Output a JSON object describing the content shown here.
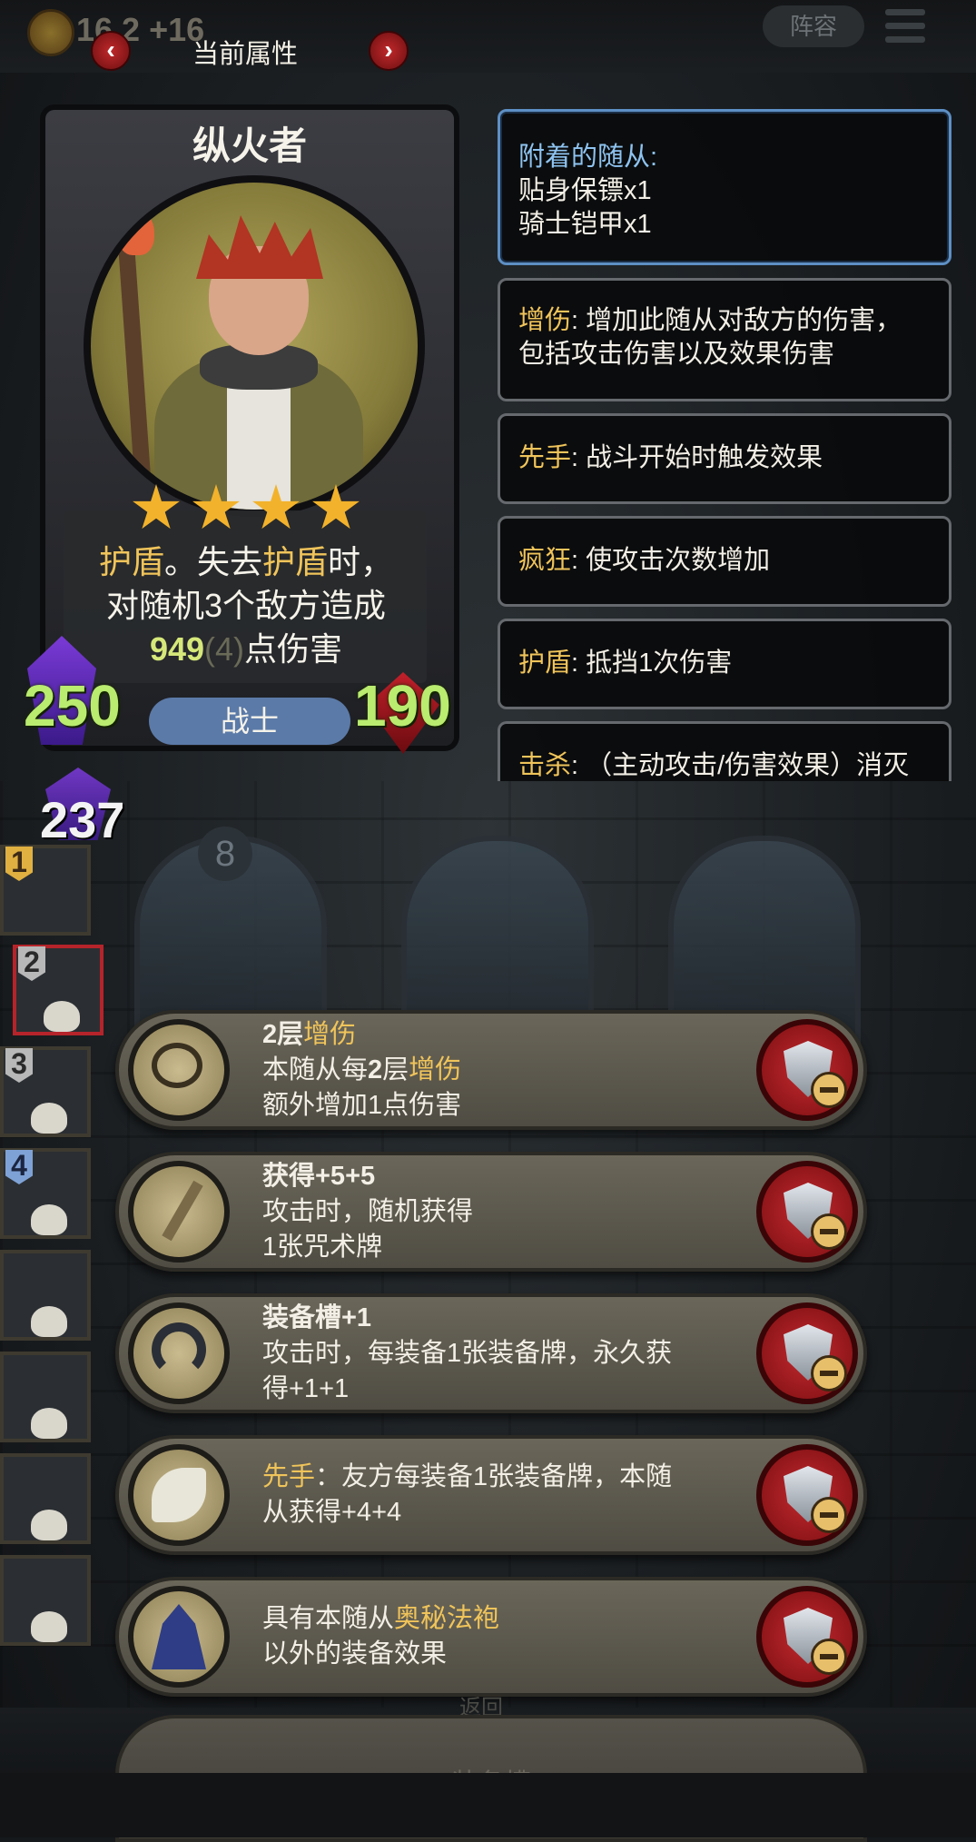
{
  "topbar": {
    "gold": "16 2 +16",
    "title": "当前属性",
    "prev": "‹",
    "next": "›",
    "lineup_label": "阵容"
  },
  "hero": {
    "name": "纵火者",
    "stars": 4,
    "desc_line1_a": "护盾",
    "desc_line1_b": "。失去",
    "desc_line1_c": "护盾",
    "desc_line1_d": "时，",
    "desc_line2": "对随机3个敌方造成",
    "desc_line3_num": "949",
    "desc_line3_sub": "(4)",
    "desc_line3_tail": "点伤害",
    "attack": "250",
    "health": "190",
    "class": "战士"
  },
  "keywords": {
    "attached_title": "附着的随从:",
    "attached_items": [
      "贴身保镖x1",
      "骑士铠甲x1"
    ],
    "list": [
      {
        "key": "增伤",
        "text": ": 增加此随从对敌方的伤害，",
        "text2": "包括攻击伤害以及效果伤害"
      },
      {
        "key": "先手",
        "text": ": 战斗开始时触发效果",
        "text2": ""
      },
      {
        "key": "疯狂",
        "text": ": 使攻击次数增加",
        "text2": ""
      },
      {
        "key": "护盾",
        "text": ": 抵挡1次伤害",
        "text2": ""
      },
      {
        "key": "击杀",
        "text": ": （主动攻击/伤害效果）消灭",
        "text2": ""
      }
    ]
  },
  "board": {
    "attack_small": "237",
    "slot_numbers": [
      "1",
      "2",
      "3",
      "4"
    ],
    "card_badge": "8"
  },
  "equipment": [
    {
      "icon": "necklace-icon",
      "l1a": "2层",
      "l1b": "增伤",
      "l2a": "本随从每",
      "l2b": "2",
      "l2c": "层",
      "l2d": "增伤",
      "l3": "额外增加1点伤害"
    },
    {
      "icon": "broom-icon",
      "l1": "获得+5+5",
      "l2": "攻击时，随机获得",
      "l3": "1张咒术牌"
    },
    {
      "icon": "horseshoe-icon",
      "l1": "装备槽+1",
      "l2": "攻击时，每装备1张装备牌，永久获",
      "l3": "得+1+1"
    },
    {
      "icon": "wing-icon",
      "l1a": "先手",
      "l1b": "：友方每装备1张装备牌，本随",
      "l2": "从获得+4+4"
    },
    {
      "icon": "robe-icon",
      "l1a": "具有本随从",
      "l1b": "奥秘法袍",
      "l2": "以外的装备效果"
    }
  ],
  "footer": {
    "return_hint": "返回",
    "empty_slot": "装备槽"
  }
}
